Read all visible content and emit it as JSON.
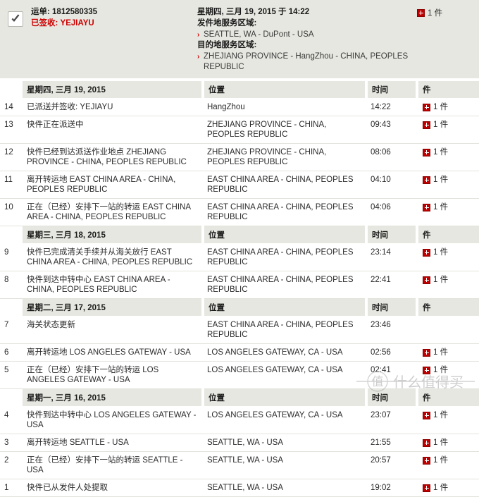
{
  "summary": {
    "checkbox_checked": true,
    "checkbox_icon": "checkmark-icon",
    "waybill_label": "运单: 1812580335",
    "status_label": "已签收: YEJIAYU",
    "delivered_datetime": "星期四, 三月 19, 2015 于 14:22",
    "origin_heading": "发件地服务区域:",
    "origin_value": "SEATTLE, WA - DuPont - USA",
    "destination_heading": "目的地服务区域:",
    "destination_value": "ZHEJIANG PROVINCE - HangZhou - CHINA, PEOPLES REPUBLIC",
    "package_icon": "expand-plus-icon",
    "package_count": "1 件"
  },
  "columns": {
    "location": "位置",
    "time": "时间",
    "pieces": "件"
  },
  "colors": {
    "header_bg": "#e7e7e1",
    "accent_red": "#cc0000",
    "badge_red": "#c00000",
    "row_border": "#e3e3dd",
    "text": "#2b2b2b"
  },
  "watermark": {
    "text": "值 什么值得买"
  },
  "groups": [
    {
      "date": "星期四, 三月 19, 2015",
      "rows": [
        {
          "num": "14",
          "activity": "已派送并签收: YEJIAYU",
          "location": "HangZhou",
          "time": "14:22",
          "pieces": "1 件",
          "has_pieces": true
        },
        {
          "num": "13",
          "activity": "快件正在派送中",
          "location": "ZHEJIANG PROVINCE - CHINA, PEOPLES REPUBLIC",
          "time": "09:43",
          "pieces": "1 件",
          "has_pieces": true
        },
        {
          "num": "12",
          "activity": "快件已经到达派送作业地点 ZHEJIANG PROVINCE - CHINA, PEOPLES REPUBLIC",
          "location": "ZHEJIANG PROVINCE - CHINA, PEOPLES REPUBLIC",
          "time": "08:06",
          "pieces": "1 件",
          "has_pieces": true
        },
        {
          "num": "11",
          "activity": "离开转运地 EAST CHINA AREA - CHINA, PEOPLES REPUBLIC",
          "location": "EAST CHINA AREA - CHINA, PEOPLES REPUBLIC",
          "time": "04:10",
          "pieces": "1 件",
          "has_pieces": true
        },
        {
          "num": "10",
          "activity": "正在（已经）安排下一站的转运 EAST CHINA AREA - CHINA, PEOPLES REPUBLIC",
          "location": "EAST CHINA AREA - CHINA, PEOPLES REPUBLIC",
          "time": "04:06",
          "pieces": "1 件",
          "has_pieces": true
        }
      ]
    },
    {
      "date": "星期三, 三月 18, 2015",
      "rows": [
        {
          "num": "9",
          "activity": "快件已完成清关手续并从海关放行 EAST CHINA AREA - CHINA, PEOPLES REPUBLIC",
          "location": "EAST CHINA AREA - CHINA, PEOPLES REPUBLIC",
          "time": "23:14",
          "pieces": "1 件",
          "has_pieces": true
        },
        {
          "num": "8",
          "activity": "快件到达中转中心 EAST CHINA AREA - CHINA, PEOPLES REPUBLIC",
          "location": "EAST CHINA AREA - CHINA, PEOPLES REPUBLIC",
          "time": "22:41",
          "pieces": "1 件",
          "has_pieces": true
        }
      ]
    },
    {
      "date": "星期二, 三月 17, 2015",
      "rows": [
        {
          "num": "7",
          "activity": "海关状态更新",
          "location": "EAST CHINA AREA - CHINA, PEOPLES REPUBLIC",
          "time": "23:46",
          "pieces": "",
          "has_pieces": false
        },
        {
          "num": "6",
          "activity": "离开转运地 LOS ANGELES GATEWAY - USA",
          "location": "LOS ANGELES GATEWAY, CA - USA",
          "time": "02:56",
          "pieces": "1 件",
          "has_pieces": true
        },
        {
          "num": "5",
          "activity": "正在（已经）安排下一站的转运 LOS ANGELES GATEWAY - USA",
          "location": "LOS ANGELES GATEWAY, CA - USA",
          "time": "02:41",
          "pieces": "1 件",
          "has_pieces": true
        }
      ]
    },
    {
      "date": "星期一, 三月 16, 2015",
      "rows": [
        {
          "num": "4",
          "activity": "快件到达中转中心 LOS ANGELES GATEWAY - USA",
          "location": "LOS ANGELES GATEWAY, CA - USA",
          "time": "23:07",
          "pieces": "1 件",
          "has_pieces": true
        },
        {
          "num": "3",
          "activity": "离开转运地 SEATTLE - USA",
          "location": "SEATTLE, WA - USA",
          "time": "21:55",
          "pieces": "1 件",
          "has_pieces": true
        },
        {
          "num": "2",
          "activity": "正在（已经）安排下一站的转运 SEATTLE - USA",
          "location": "SEATTLE, WA - USA",
          "time": "20:57",
          "pieces": "1 件",
          "has_pieces": true
        },
        {
          "num": "1",
          "activity": "快件已从发件人处提取",
          "location": "SEATTLE, WA - USA",
          "time": "19:02",
          "pieces": "1 件",
          "has_pieces": true
        }
      ]
    }
  ]
}
